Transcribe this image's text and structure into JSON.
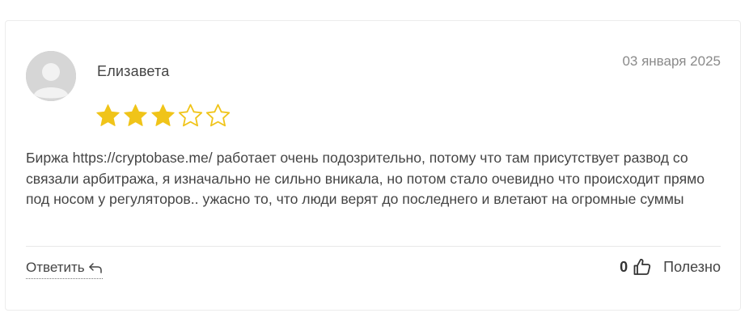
{
  "review": {
    "author": "Елизавета",
    "date": "03 января 2025",
    "rating": 3,
    "rating_max": 5,
    "text": "Биржа https://cryptobase.me/ работает очень подозрительно, потому что там присутствует развод со связали арбитража, я изначально не сильно вникала, но потом стало очевидно что происходит прямо под носом у регуляторов.. ужасно то, что люди верят до последнего и влетают на огромные суммы"
  },
  "actions": {
    "reply_label": "Ответить",
    "helpful_count": "0",
    "helpful_label": "Полезно"
  },
  "icons": {
    "avatar": "user-placeholder-icon",
    "star": "star-icon",
    "reply": "reply-arrow-icon",
    "helpful": "thumbs-up-icon"
  },
  "colors": {
    "star_filled": "#f0c419",
    "star_outline": "#f0c419",
    "date_text": "#8a8a8a",
    "divider": "#e8e8e8"
  }
}
